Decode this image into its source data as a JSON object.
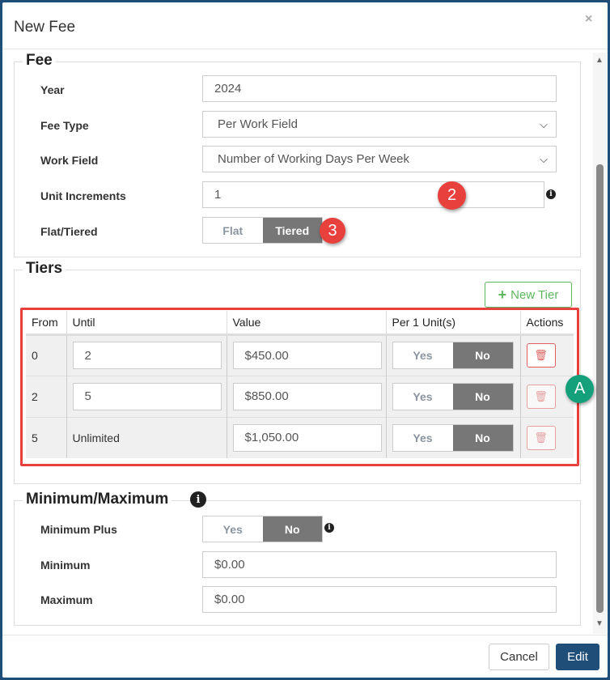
{
  "dialog": {
    "title": "New Fee",
    "close": "×"
  },
  "fee": {
    "legend": "Fee",
    "year": {
      "label": "Year",
      "value": "2024"
    },
    "fee_type": {
      "label": "Fee Type",
      "value": "Per Work Field"
    },
    "work_field": {
      "label": "Work Field",
      "value": "Number of Working Days Per Week"
    },
    "unit_increments": {
      "label": "Unit Increments",
      "value": "1"
    },
    "flat_tiered": {
      "label": "Flat/Tiered",
      "options": [
        "Flat",
        "Tiered"
      ],
      "selected": "Tiered"
    }
  },
  "tiers": {
    "legend": "Tiers",
    "new_tier": "New Tier",
    "columns": [
      "From",
      "Until",
      "Value",
      "Per 1 Unit(s)",
      "Actions"
    ],
    "rows": [
      {
        "from": "0",
        "until": "2",
        "value": "$450.00",
        "per_yes": "Yes",
        "per_no": "No"
      },
      {
        "from": "2",
        "until": "5",
        "value": "$850.00",
        "per_yes": "Yes",
        "per_no": "No"
      },
      {
        "from": "5",
        "until": "Unlimited",
        "value": "$1,050.00",
        "per_yes": "Yes",
        "per_no": "No"
      }
    ]
  },
  "minmax": {
    "legend": "Minimum/Maximum",
    "minimum_plus": {
      "label": "Minimum Plus",
      "yes": "Yes",
      "no": "No",
      "selected": "No"
    },
    "minimum": {
      "label": "Minimum",
      "value": "$0.00"
    },
    "maximum": {
      "label": "Maximum",
      "value": "$0.00"
    }
  },
  "annotations": {
    "b2": "2",
    "b3": "3",
    "bA": "A"
  },
  "footer": {
    "cancel": "Cancel",
    "edit": "Edit"
  },
  "colors": {
    "primary": "#1f4e79",
    "callout_red": "#e8403c",
    "callout_teal": "#15a07c",
    "new_tier_green": "#5cb85c"
  }
}
